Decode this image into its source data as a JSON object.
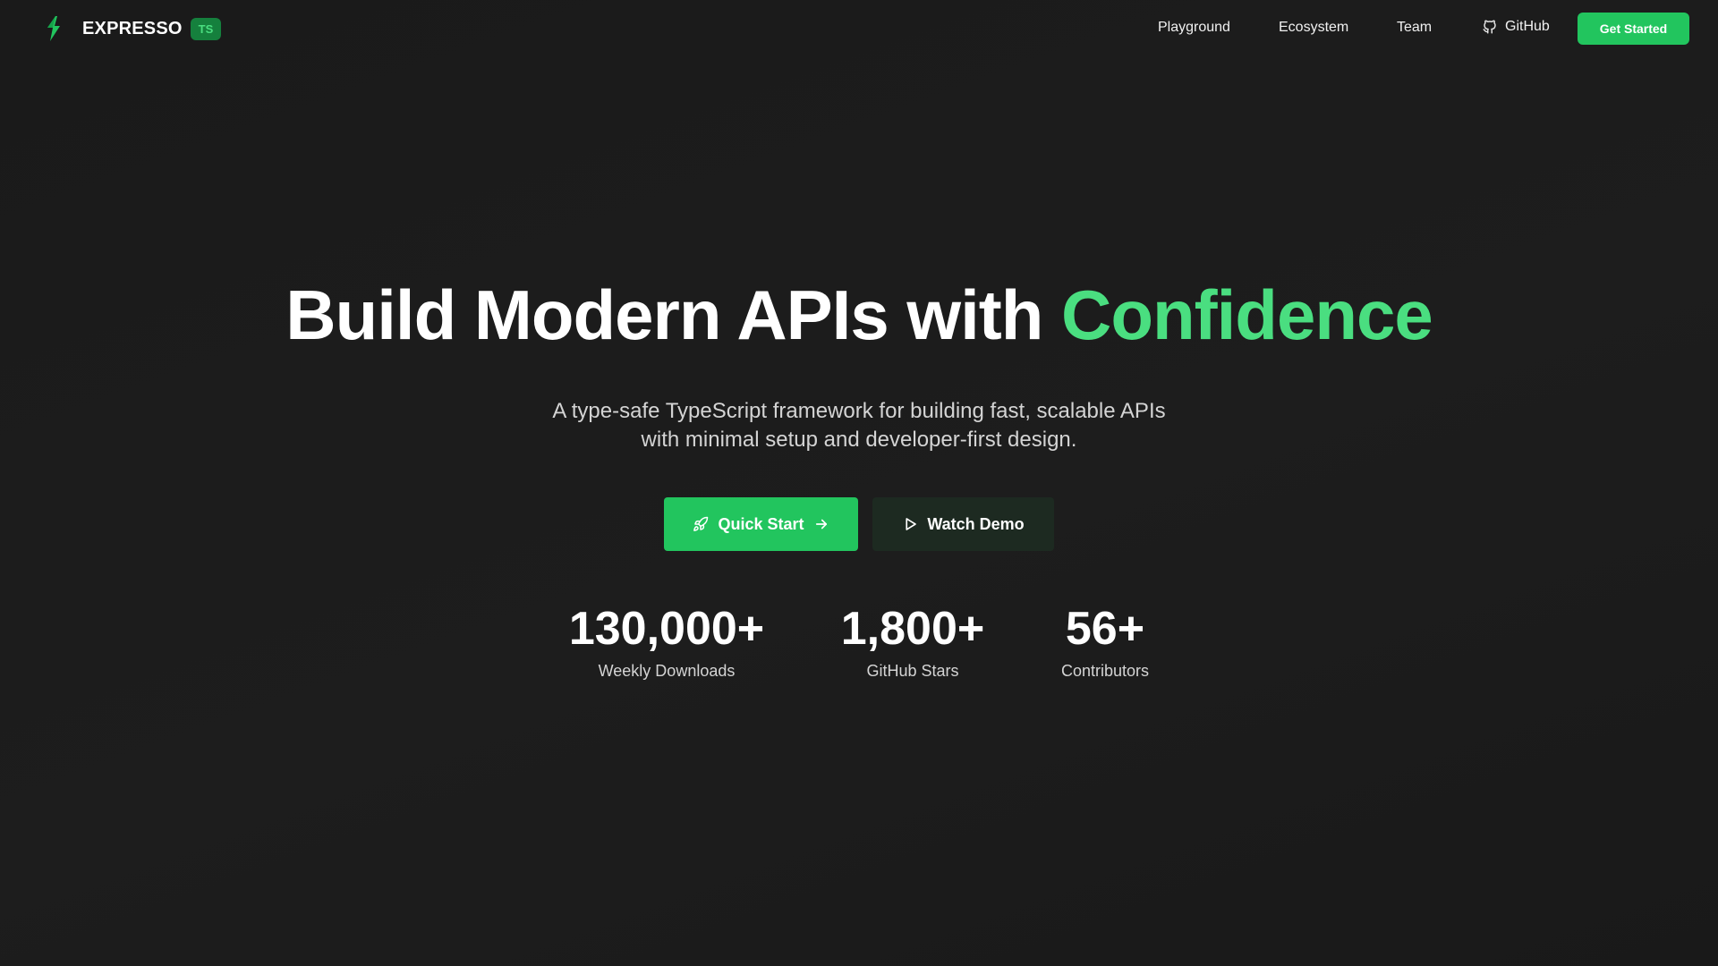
{
  "brand": {
    "name": "EXPRESSO",
    "badge": "TS",
    "logo_icon": "lightning-leaf-icon"
  },
  "nav": {
    "links": [
      {
        "label": "Playground"
      },
      {
        "label": "Ecosystem"
      },
      {
        "label": "Team"
      },
      {
        "label": "GitHub",
        "icon": "github-icon"
      }
    ],
    "cta_label": "Get Started"
  },
  "hero": {
    "title_main": "Build Modern APIs with ",
    "title_accent": "Confidence",
    "subtitle_line1": "A type-safe TypeScript framework for building fast, scalable APIs",
    "subtitle_line2": "with minimal setup and developer-first design."
  },
  "actions": {
    "quick_start": {
      "label": "Quick Start",
      "icon_left": "rocket-icon",
      "icon_right": "arrow-right-icon"
    },
    "watch_demo": {
      "label": "Watch Demo",
      "icon_left": "play-icon"
    }
  },
  "stats": [
    {
      "value": "130,000+",
      "label": "Weekly Downloads"
    },
    {
      "value": "1,800+",
      "label": "GitHub Stars"
    },
    {
      "value": "56+",
      "label": "Contributors"
    }
  ],
  "colors": {
    "background": "#1b1b1b",
    "accent": "#22c55e",
    "accent_text": "#4ade80",
    "badge_bg": "#15803d",
    "demo_button_bg": "#1d2a21"
  }
}
